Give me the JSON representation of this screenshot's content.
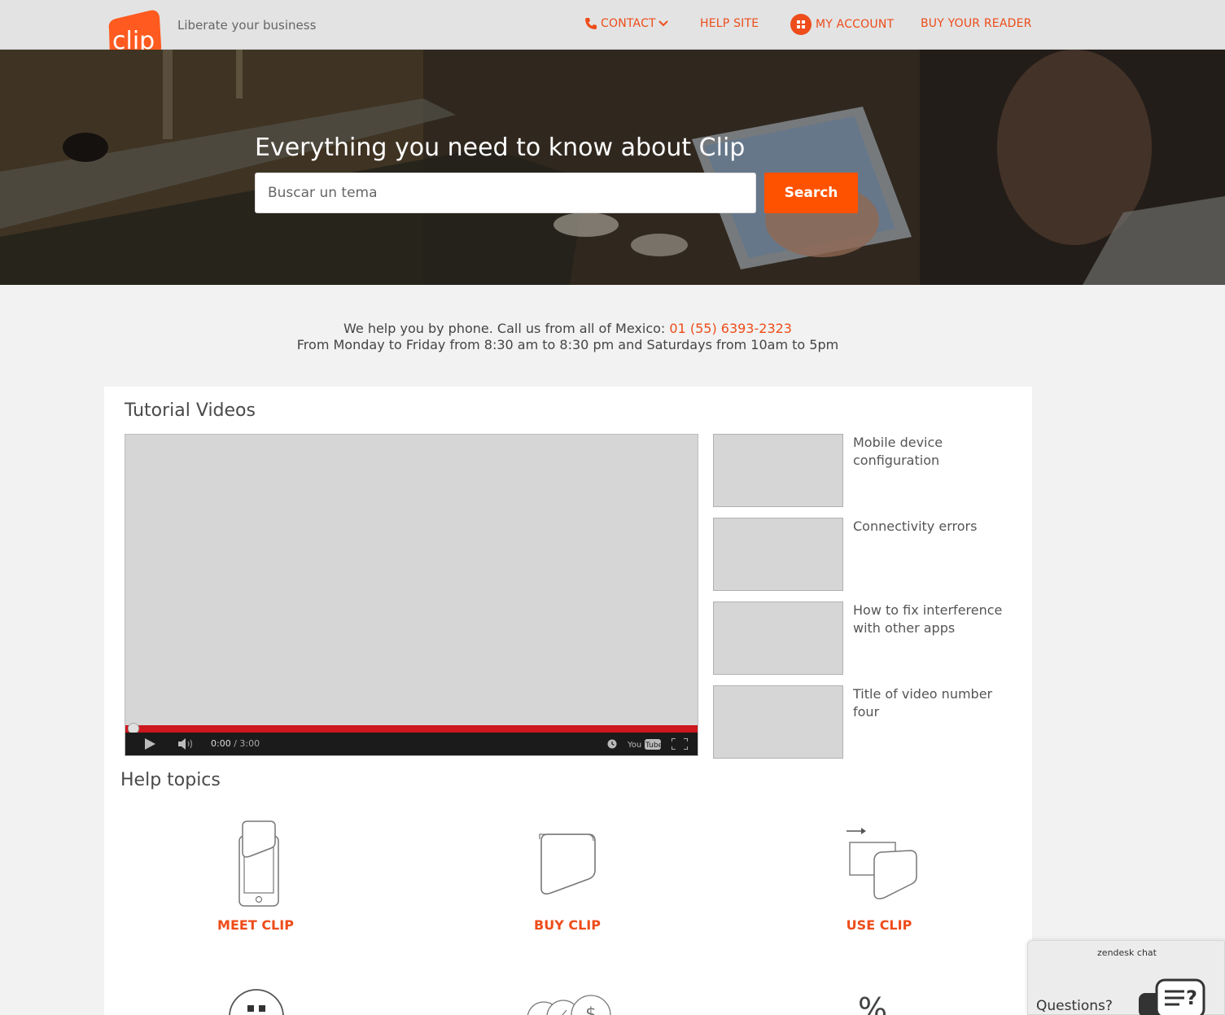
{
  "header": {
    "logo_text": "clip",
    "tagline": "Liberate your business",
    "nav": {
      "contact": "CONTACT",
      "help_site": "HELP SITE",
      "my_account": "MY ACCOUNT",
      "buy_reader": "BUY YOUR READER"
    }
  },
  "hero": {
    "title": "Everything you need to know about Clip",
    "search_placeholder": "Buscar un tema",
    "search_button": "Search"
  },
  "phone_info": {
    "line1_prefix": "We help you by phone. Call us from all of Mexico: ",
    "phone_number": "01 (55) 6393-2323",
    "line2": "From Monday to Friday from 8:30 am to 8:30 pm and Saturdays from 10am to 5pm"
  },
  "tutorials": {
    "title": "Tutorial Videos",
    "player": {
      "current_time": "0:00",
      "separator": " / ",
      "duration": "3:00",
      "progress": 0
    },
    "videos": [
      {
        "title": "Mobile device configuration"
      },
      {
        "title": "Connectivity errors"
      },
      {
        "title": "How to fix interference with other apps"
      },
      {
        "title": "Title of video number four"
      }
    ]
  },
  "help_topics": {
    "title": "Help topics",
    "items": [
      {
        "label": "MEET CLIP",
        "icon": "phone-reader-icon"
      },
      {
        "label": "BUY CLIP",
        "icon": "reader-card-icon"
      },
      {
        "label": "USE CLIP",
        "icon": "transfer-cards-icon"
      }
    ]
  },
  "zendesk": {
    "brand": "zendesk chat",
    "prompt": "Questions?"
  },
  "colors": {
    "accent": "#ee4c1a",
    "search_button": "#ff5200",
    "header_bg": "#e3e3e3",
    "page_bg": "#f2f2f2",
    "progress_red": "#cc181e"
  }
}
